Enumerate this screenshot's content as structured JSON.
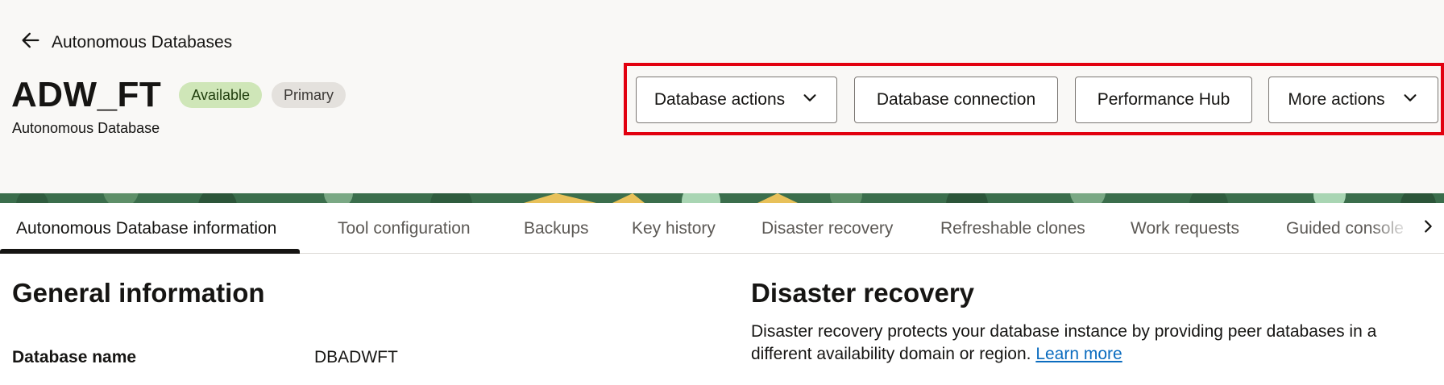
{
  "header": {
    "back_label": "Autonomous Databases",
    "title": "ADW_FT",
    "subtitle": "Autonomous Database",
    "badges": [
      {
        "label": "Available",
        "color": "#cfe6b8"
      },
      {
        "label": "Primary",
        "color": "#e4e1dd"
      }
    ],
    "actions": [
      {
        "label": "Database actions",
        "has_dropdown": true
      },
      {
        "label": "Database connection",
        "has_dropdown": false
      },
      {
        "label": "Performance Hub",
        "has_dropdown": false
      },
      {
        "label": "More actions",
        "has_dropdown": true
      }
    ],
    "highlight_color": "#e2000f"
  },
  "tabs": [
    {
      "label": "Autonomous Database information",
      "active": true
    },
    {
      "label": "Tool configuration",
      "active": false
    },
    {
      "label": "Backups",
      "active": false
    },
    {
      "label": "Key history",
      "active": false
    },
    {
      "label": "Disaster recovery",
      "active": false
    },
    {
      "label": "Refreshable clones",
      "active": false
    },
    {
      "label": "Work requests",
      "active": false
    },
    {
      "label": "Guided console",
      "active": false
    }
  ],
  "general_info": {
    "title": "General information",
    "fields": [
      {
        "label": "Database name",
        "value": "DBADWFT"
      }
    ]
  },
  "disaster_recovery": {
    "title": "Disaster recovery",
    "description": "Disaster recovery protects your database instance by providing peer databases in a different availability domain or region.",
    "link_label": "Learn more"
  },
  "icons": {
    "back": "arrow-left-icon",
    "dropdown": "chevron-down-icon",
    "tab_scroll": "chevron-right-icon"
  }
}
